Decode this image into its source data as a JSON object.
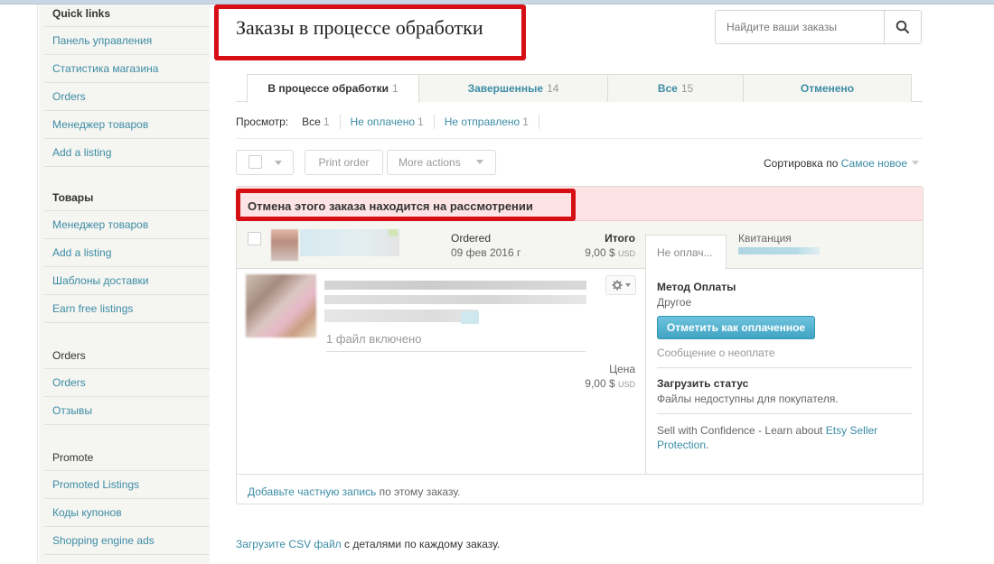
{
  "sidebar": {
    "sections": [
      {
        "heading": "Quick links",
        "items": [
          "Панель управления",
          "Статистика магазина",
          "Orders",
          "Менеджер товаров",
          "Add a listing"
        ]
      },
      {
        "heading": "Товары",
        "items": [
          "Менеджер товаров",
          "Add a listing",
          "Шаблоны доставки",
          "Earn free listings"
        ]
      },
      {
        "heading": "Orders",
        "items": [
          "Orders",
          "Отзывы"
        ]
      },
      {
        "heading": "Promote",
        "items": [
          "Promoted Listings",
          "Коды купонов",
          "Shopping engine ads"
        ]
      }
    ]
  },
  "page": {
    "title": "Заказы в процессе обработки",
    "highlight_color": "#d50f14"
  },
  "search": {
    "placeholder": "Найдите ваши заказы",
    "value": ""
  },
  "tabs": [
    {
      "label": "В процессе обработки",
      "count": "1",
      "active": true
    },
    {
      "label": "Завершенные",
      "count": "14",
      "active": false
    },
    {
      "label": "Все",
      "count": "15",
      "active": false
    },
    {
      "label": "Отменено",
      "count": "",
      "active": false
    }
  ],
  "filter": {
    "label": "Просмотр:",
    "options": [
      {
        "label": "Все",
        "count": "1"
      },
      {
        "label": "Не оплачено",
        "count": "1"
      },
      {
        "label": "Не отправлено",
        "count": "1"
      }
    ]
  },
  "toolbar": {
    "print_label": "Print order",
    "more_actions_label": "More actions",
    "sort_prefix": "Сортировка по",
    "sort_value": "Самое новое"
  },
  "order": {
    "alert": "Отмена этого заказа находится на рассмотрении",
    "status_label": "Ordered",
    "date": "09 фев 2016 г",
    "total_label": "Итого",
    "total_value": "9,00 $",
    "currency": "USD",
    "payment_tab": "Не оплач...",
    "receipt_label": "Квитанция",
    "files_included": "1 файл включено",
    "price_label": "Цена",
    "price_value": "9,00 $",
    "payment_method_label": "Метод Оплаты",
    "payment_method_value": "Другое",
    "mark_paid_button": "Отметить как оплаченное",
    "unpaid_message_link": "Сообщение о неоплате",
    "upload_status_label": "Загрузить статус",
    "upload_status_value": "Файлы недоступны для покупателя.",
    "sell_confidence_text": "Sell with Confidence - Learn about",
    "seller_protection_link": "Etsy Seller Protection",
    "sell_confidence_end": ".",
    "private_note_link": "Добавьте частную запись",
    "private_note_text": "по этому заказу."
  },
  "footer": {
    "csv_link": "Загрузите CSV файл",
    "csv_text": "с деталями по каждому заказу."
  }
}
